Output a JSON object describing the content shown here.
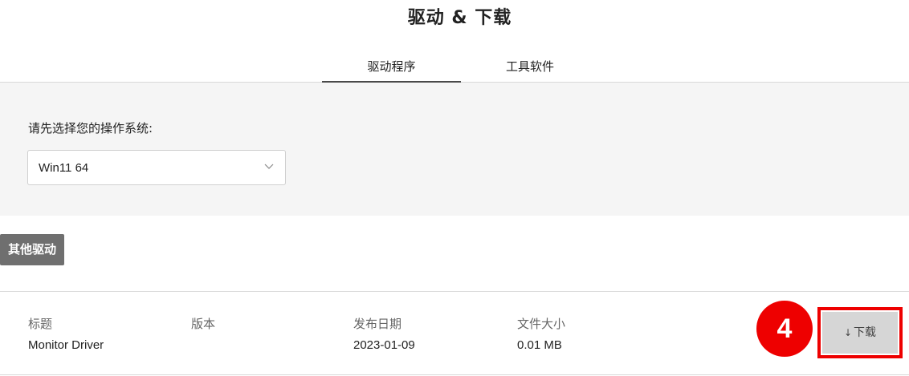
{
  "page": {
    "title": "驱动 & 下载"
  },
  "tabs": [
    {
      "label": "驱动程序",
      "active": true
    },
    {
      "label": "工具软件",
      "active": false
    }
  ],
  "os_selector": {
    "prompt": "请先选择您的操作系统:",
    "selected": "Win11 64",
    "chevron_icon": "chevron-down-icon"
  },
  "section": {
    "other_drivers_label": "其他驱动"
  },
  "driver_table": {
    "headers": {
      "title": "标题",
      "version": "版本",
      "release_date": "发布日期",
      "file_size": "文件大小"
    },
    "rows": [
      {
        "title": "Monitor Driver",
        "version": "",
        "release_date": "2023-01-09",
        "file_size": "0.01 MB"
      }
    ]
  },
  "annotation": {
    "step_number": "4",
    "color": "#ee0000"
  },
  "download": {
    "arrow": "↓",
    "label": "下载"
  }
}
